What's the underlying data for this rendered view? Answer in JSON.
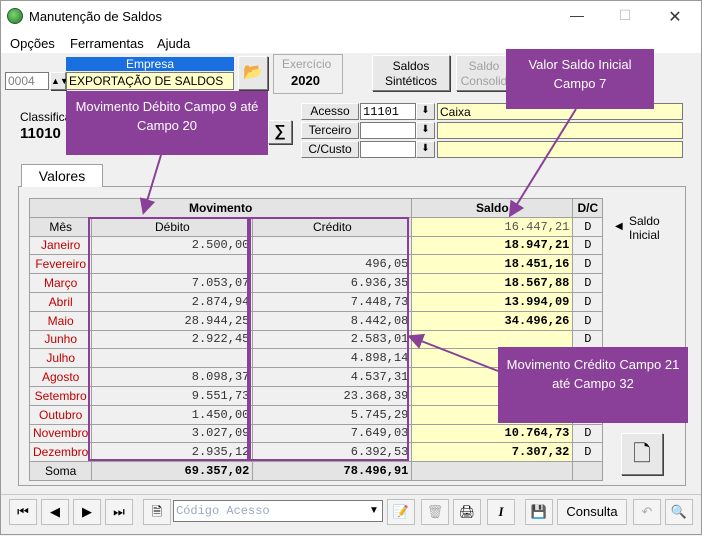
{
  "window": {
    "title": "Manutenção de Saldos"
  },
  "menu": {
    "opcoes": "Opções",
    "ferramentas": "Ferramentas",
    "ajuda": "Ajuda"
  },
  "empresa": {
    "label": "Empresa",
    "code": "0004",
    "name": "EXPORTAÇÃO DE SALDOS"
  },
  "exercicio": {
    "label": "Exercício",
    "year": "2020"
  },
  "buttons": {
    "saldos_sinteticos": "Saldos Sintéticos",
    "saldos_consolidados": "Saldo Consolid"
  },
  "classificacao": {
    "label": "Classifica",
    "value": "11010"
  },
  "conta": {
    "acesso_label": "Acesso",
    "acesso_value": "11101",
    "acesso_desc": "Caixa",
    "terceiro_label": "Terceiro",
    "ccusto_label": "C/Custo"
  },
  "tab": {
    "label": "Valores"
  },
  "grid": {
    "group_movimento": "Movimento",
    "group_saldo": "Saldo",
    "col_dc": "D/C",
    "col_mes": "Mês",
    "col_debito": "Débito",
    "col_credito": "Crédito",
    "saldo_inicial": "16.447,21",
    "saldo_inicial_dc": "D",
    "rows": [
      {
        "mes": "Janeiro",
        "debito": "2.500,00",
        "credito": "",
        "saldo": "18.947,21",
        "dc": "D"
      },
      {
        "mes": "Fevereiro",
        "debito": "",
        "credito": "496,05",
        "saldo": "18.451,16",
        "dc": "D"
      },
      {
        "mes": "Março",
        "debito": "7.053,07",
        "credito": "6.936,35",
        "saldo": "18.567,88",
        "dc": "D"
      },
      {
        "mes": "Abril",
        "debito": "2.874,94",
        "credito": "7.448,73",
        "saldo": "13.994,09",
        "dc": "D"
      },
      {
        "mes": "Maio",
        "debito": "28.944,25",
        "credito": "8.442,08",
        "saldo": "34.496,26",
        "dc": "D"
      },
      {
        "mes": "Junho",
        "debito": "2.922,45",
        "credito": "2.583,01",
        "saldo": "",
        "dc": "D"
      },
      {
        "mes": "Julho",
        "debito": "",
        "credito": "4.898,14",
        "saldo": "",
        "dc": "D"
      },
      {
        "mes": "Agosto",
        "debito": "8.098,37",
        "credito": "4.537,31",
        "saldo": "",
        "dc": "D"
      },
      {
        "mes": "Setembro",
        "debito": "9.551,73",
        "credito": "23.368,39",
        "saldo": "",
        "dc": "D"
      },
      {
        "mes": "Outubro",
        "debito": "1.450,00",
        "credito": "5.745,29",
        "saldo": "",
        "dc": "D"
      },
      {
        "mes": "Novembro",
        "debito": "3.027,09",
        "credito": "7.649,03",
        "saldo": "10.764,73",
        "dc": "D"
      },
      {
        "mes": "Dezembro",
        "debito": "2.935,12",
        "credito": "6.392,53",
        "saldo": "7.307,32",
        "dc": "D"
      }
    ],
    "soma_label": "Soma",
    "soma_debito": "69.357,02",
    "soma_credito": "78.496,91"
  },
  "side": {
    "saldo_inicial_label": "Saldo Inicial"
  },
  "callouts": {
    "debito": "Movimento Débito Campo 9 até Campo 20",
    "saldo_inicial": "Valor Saldo Inicial Campo 7",
    "credito": "Movimento Crédito Campo 21 até Campo 32"
  },
  "toolbar": {
    "codigo_acesso_placeholder": "Código Acesso",
    "consulta_label": "Consulta"
  }
}
